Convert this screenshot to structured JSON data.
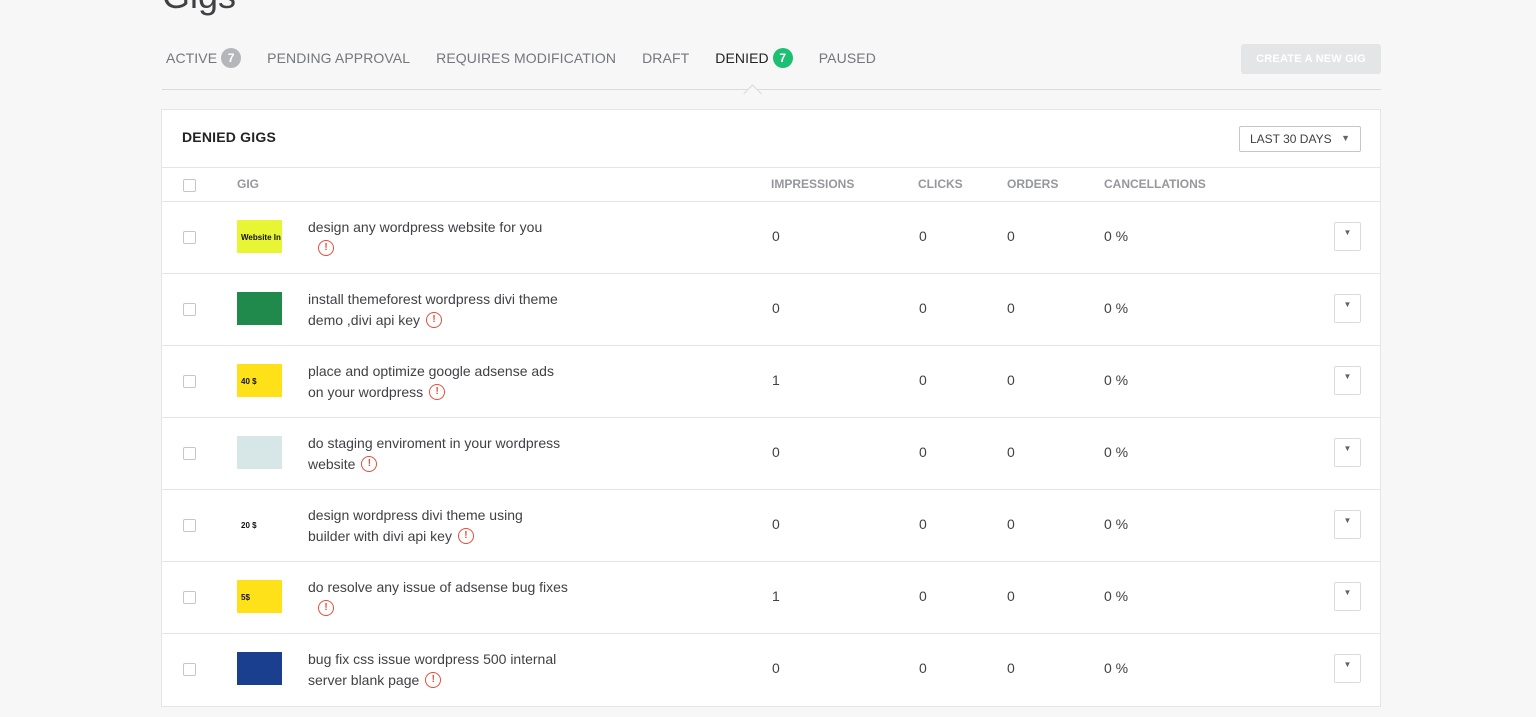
{
  "page": {
    "title": "Gigs"
  },
  "tabs": [
    {
      "label": "ACTIVE",
      "count": "7"
    },
    {
      "label": "PENDING APPROVAL"
    },
    {
      "label": "REQUIRES MODIFICATION"
    },
    {
      "label": "DRAFT"
    },
    {
      "label": "DENIED",
      "count": "7",
      "selected": true
    },
    {
      "label": "PAUSED"
    }
  ],
  "create_button": "CREATE A NEW GIG",
  "panel": {
    "title": "DENIED GIGS",
    "range": "LAST 30 DAYS",
    "columns": {
      "gig": "GIG",
      "impressions": "IMPRESSIONS",
      "clicks": "CLICKS",
      "orders": "ORDERS",
      "cancellations": "CANCELLATIONS"
    }
  },
  "gigs": [
    {
      "title_line1": "design any wordpress website for you",
      "title_line2": "",
      "impressions": "0",
      "clicks": "0",
      "orders": "0",
      "cancellations": "0 %",
      "thumb_text": "Website In Wordpress",
      "thumb_color": "#e8f534"
    },
    {
      "title_line1": "install themeforest wordpress divi theme",
      "title_line2": "demo ,divi api key",
      "impressions": "0",
      "clicks": "0",
      "orders": "0",
      "cancellations": "0 %",
      "thumb_text": "",
      "thumb_color": "#1f8a4c"
    },
    {
      "title_line1": "place and optimize google adsense ads",
      "title_line2": "on your wordpress",
      "impressions": "1",
      "clicks": "0",
      "orders": "0",
      "cancellations": "0 %",
      "thumb_text": "40 $",
      "thumb_color": "#ffe11a"
    },
    {
      "title_line1": "do staging enviroment in your wordpress",
      "title_line2": "website",
      "impressions": "0",
      "clicks": "0",
      "orders": "0",
      "cancellations": "0 %",
      "thumb_text": "",
      "thumb_color": "#d7e6e6"
    },
    {
      "title_line1": "design wordpress divi theme using",
      "title_line2": "builder with divi api key",
      "impressions": "0",
      "clicks": "0",
      "orders": "0",
      "cancellations": "0 %",
      "thumb_text": "20 $",
      "thumb_color": "#ffffff"
    },
    {
      "title_line1": "do resolve any issue of adsense bug fixes",
      "title_line2": "",
      "impressions": "1",
      "clicks": "0",
      "orders": "0",
      "cancellations": "0 %",
      "thumb_text": "5$",
      "thumb_color": "#ffe11a"
    },
    {
      "title_line1": "bug fix css issue wordpress 500 internal",
      "title_line2": "server blank page",
      "impressions": "0",
      "clicks": "0",
      "orders": "0",
      "cancellations": "0 %",
      "thumb_text": "",
      "thumb_color": "#1b3f8f"
    }
  ],
  "icons": {
    "warning": "exclamation-circle-icon",
    "dropdown": "caret-down-icon"
  },
  "colors": {
    "accent_green": "#1dbf73",
    "warning_red": "#e74c3c"
  }
}
